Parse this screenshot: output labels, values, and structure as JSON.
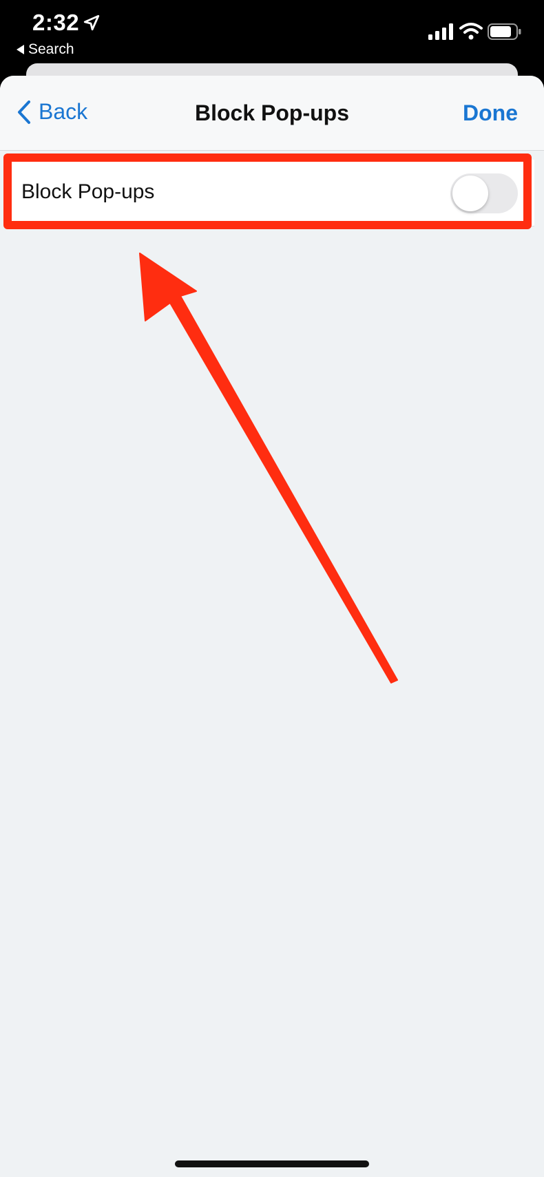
{
  "status_bar": {
    "time": "2:32",
    "back_app_label": "Search",
    "icons": [
      "location-arrow-icon",
      "cellular-signal-icon",
      "wifi-icon",
      "battery-icon"
    ]
  },
  "nav": {
    "back_label": "Back",
    "title": "Block Pop-ups",
    "done_label": "Done"
  },
  "settings": {
    "rows": [
      {
        "label": "Block Pop-ups",
        "toggle_on": false
      }
    ]
  },
  "colors": {
    "accent": "#1a76d2",
    "annotation": "#ff2d10",
    "background": "#eff2f4",
    "toggle_off_track": "#e9e9eb"
  }
}
